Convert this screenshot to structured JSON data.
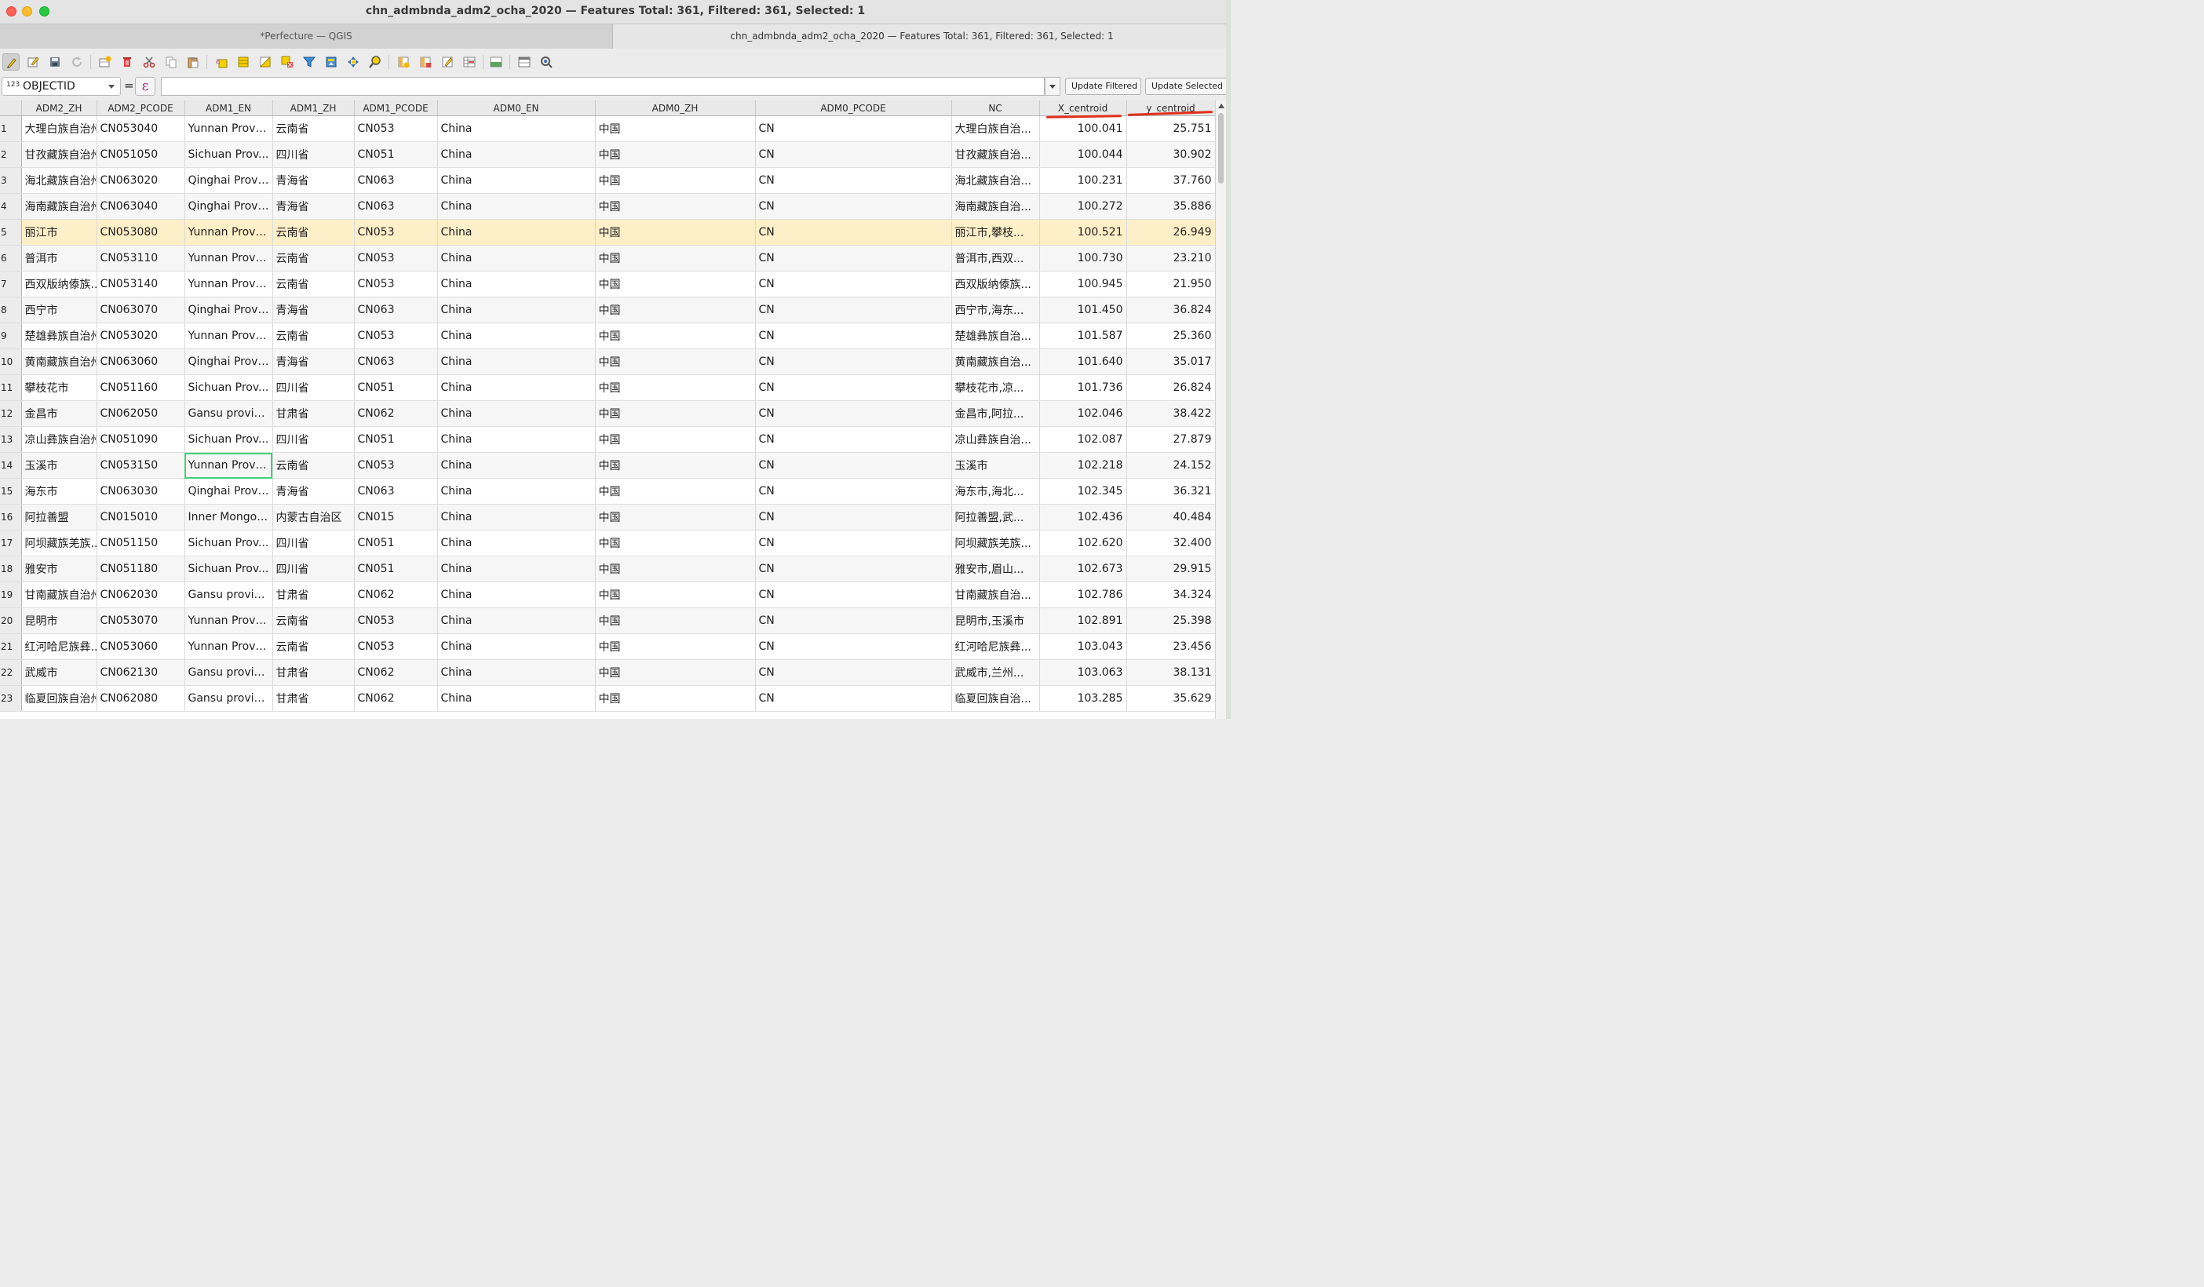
{
  "window": {
    "title": "chn_admbnda_adm2_ocha_2020 — Features Total: 361, Filtered: 361, Selected: 1"
  },
  "tabs": [
    {
      "label": "*Perfecture — QGIS"
    },
    {
      "label": "chn_admbnda_adm2_ocha_2020 — Features Total: 361, Filtered: 361, Selected: 1"
    }
  ],
  "toolbar": {
    "icons": [
      "pencil-icon",
      "multi-edit-icon",
      "save-icon",
      "reload-icon",
      "add-feature-icon",
      "delete-icon",
      "cut-icon",
      "copy-icon",
      "paste-icon",
      "expression-select-icon",
      "select-all-icon",
      "invert-selection-icon",
      "deselect-icon",
      "filter-icon",
      "move-selection-top-icon",
      "pan-to-selection-icon",
      "zoom-to-selection-icon",
      "new-field-icon",
      "delete-field-icon",
      "field-calculator-icon",
      "conditional-format-icon",
      "dock-icon",
      "table-view-icon",
      "actions-icon"
    ]
  },
  "filter": {
    "field_type": "123",
    "field": "OBJECTID",
    "operator": "=",
    "expression_glyph": "ε",
    "value": "",
    "update_filtered": "Update Filtered",
    "update_selected": "Update Selected"
  },
  "table": {
    "columns": [
      "ADM2_ZH",
      "ADM2_PCODE",
      "ADM1_EN",
      "ADM1_ZH",
      "ADM1_PCODE",
      "ADM0_EN",
      "ADM0_ZH",
      "ADM0_PCODE",
      "NC",
      "X_centroid",
      "y_centroid"
    ],
    "selected_row": 5,
    "current_cell": {
      "row": 14,
      "column": "ADM1_EN"
    },
    "rows": [
      [
        "1",
        "大理白族自治州",
        "CN053040",
        "Yunnan Provi...",
        "云南省",
        "CN053",
        "China",
        "中国",
        "CN",
        "大理白族自治...",
        "100.041",
        "25.751"
      ],
      [
        "2",
        "甘孜藏族自治州",
        "CN051050",
        "Sichuan Prov...",
        "四川省",
        "CN051",
        "China",
        "中国",
        "CN",
        "甘孜藏族自治...",
        "100.044",
        "30.902"
      ],
      [
        "3",
        "海北藏族自治州",
        "CN063020",
        "Qinghai Provi...",
        "青海省",
        "CN063",
        "China",
        "中国",
        "CN",
        "海北藏族自治...",
        "100.231",
        "37.760"
      ],
      [
        "4",
        "海南藏族自治州",
        "CN063040",
        "Qinghai Provi...",
        "青海省",
        "CN063",
        "China",
        "中国",
        "CN",
        "海南藏族自治...",
        "100.272",
        "35.886"
      ],
      [
        "5",
        "丽江市",
        "CN053080",
        "Yunnan Provi...",
        "云南省",
        "CN053",
        "China",
        "中国",
        "CN",
        "丽江市,攀枝...",
        "100.521",
        "26.949"
      ],
      [
        "6",
        "普洱市",
        "CN053110",
        "Yunnan Provi...",
        "云南省",
        "CN053",
        "China",
        "中国",
        "CN",
        "普洱市,西双...",
        "100.730",
        "23.210"
      ],
      [
        "7",
        "西双版纳傣族...",
        "CN053140",
        "Yunnan Provi...",
        "云南省",
        "CN053",
        "China",
        "中国",
        "CN",
        "西双版纳傣族...",
        "100.945",
        "21.950"
      ],
      [
        "8",
        "西宁市",
        "CN063070",
        "Qinghai Provi...",
        "青海省",
        "CN063",
        "China",
        "中国",
        "CN",
        "西宁市,海东...",
        "101.450",
        "36.824"
      ],
      [
        "9",
        "楚雄彝族自治州",
        "CN053020",
        "Yunnan Provi...",
        "云南省",
        "CN053",
        "China",
        "中国",
        "CN",
        "楚雄彝族自治...",
        "101.587",
        "25.360"
      ],
      [
        "10",
        "黄南藏族自治州",
        "CN063060",
        "Qinghai Provi...",
        "青海省",
        "CN063",
        "China",
        "中国",
        "CN",
        "黄南藏族自治...",
        "101.640",
        "35.017"
      ],
      [
        "11",
        "攀枝花市",
        "CN051160",
        "Sichuan Prov...",
        "四川省",
        "CN051",
        "China",
        "中国",
        "CN",
        "攀枝花市,凉...",
        "101.736",
        "26.824"
      ],
      [
        "12",
        "金昌市",
        "CN062050",
        "Gansu provin...",
        "甘肃省",
        "CN062",
        "China",
        "中国",
        "CN",
        "金昌市,阿拉...",
        "102.046",
        "38.422"
      ],
      [
        "13",
        "凉山彝族自治州",
        "CN051090",
        "Sichuan Prov...",
        "四川省",
        "CN051",
        "China",
        "中国",
        "CN",
        "凉山彝族自治...",
        "102.087",
        "27.879"
      ],
      [
        "14",
        "玉溪市",
        "CN053150",
        "Yunnan Provi...",
        "云南省",
        "CN053",
        "China",
        "中国",
        "CN",
        "玉溪市",
        "102.218",
        "24.152"
      ],
      [
        "15",
        "海东市",
        "CN063030",
        "Qinghai Provi...",
        "青海省",
        "CN063",
        "China",
        "中国",
        "CN",
        "海东市,海北...",
        "102.345",
        "36.321"
      ],
      [
        "16",
        "阿拉善盟",
        "CN015010",
        "Inner Mongoli...",
        "内蒙古自治区",
        "CN015",
        "China",
        "中国",
        "CN",
        "阿拉善盟,武...",
        "102.436",
        "40.484"
      ],
      [
        "17",
        "阿坝藏族羌族...",
        "CN051150",
        "Sichuan Prov...",
        "四川省",
        "CN051",
        "China",
        "中国",
        "CN",
        "阿坝藏族羌族...",
        "102.620",
        "32.400"
      ],
      [
        "18",
        "雅安市",
        "CN051180",
        "Sichuan Prov...",
        "四川省",
        "CN051",
        "China",
        "中国",
        "CN",
        "雅安市,眉山...",
        "102.673",
        "29.915"
      ],
      [
        "19",
        "甘南藏族自治州",
        "CN062030",
        "Gansu provin...",
        "甘肃省",
        "CN062",
        "China",
        "中国",
        "CN",
        "甘南藏族自治...",
        "102.786",
        "34.324"
      ],
      [
        "20",
        "昆明市",
        "CN053070",
        "Yunnan Provi...",
        "云南省",
        "CN053",
        "China",
        "中国",
        "CN",
        "昆明市,玉溪市",
        "102.891",
        "25.398"
      ],
      [
        "21",
        "红河哈尼族彝...",
        "CN053060",
        "Yunnan Provi...",
        "云南省",
        "CN053",
        "China",
        "中国",
        "CN",
        "红河哈尼族彝...",
        "103.043",
        "23.456"
      ],
      [
        "22",
        "武威市",
        "CN062130",
        "Gansu provin...",
        "甘肃省",
        "CN062",
        "China",
        "中国",
        "CN",
        "武威市,兰州...",
        "103.063",
        "38.131"
      ],
      [
        "23",
        "临夏回族自治州",
        "CN062080",
        "Gansu provin...",
        "甘肃省",
        "CN062",
        "China",
        "中国",
        "CN",
        "临夏回族自治...",
        "103.285",
        "35.629"
      ]
    ]
  }
}
